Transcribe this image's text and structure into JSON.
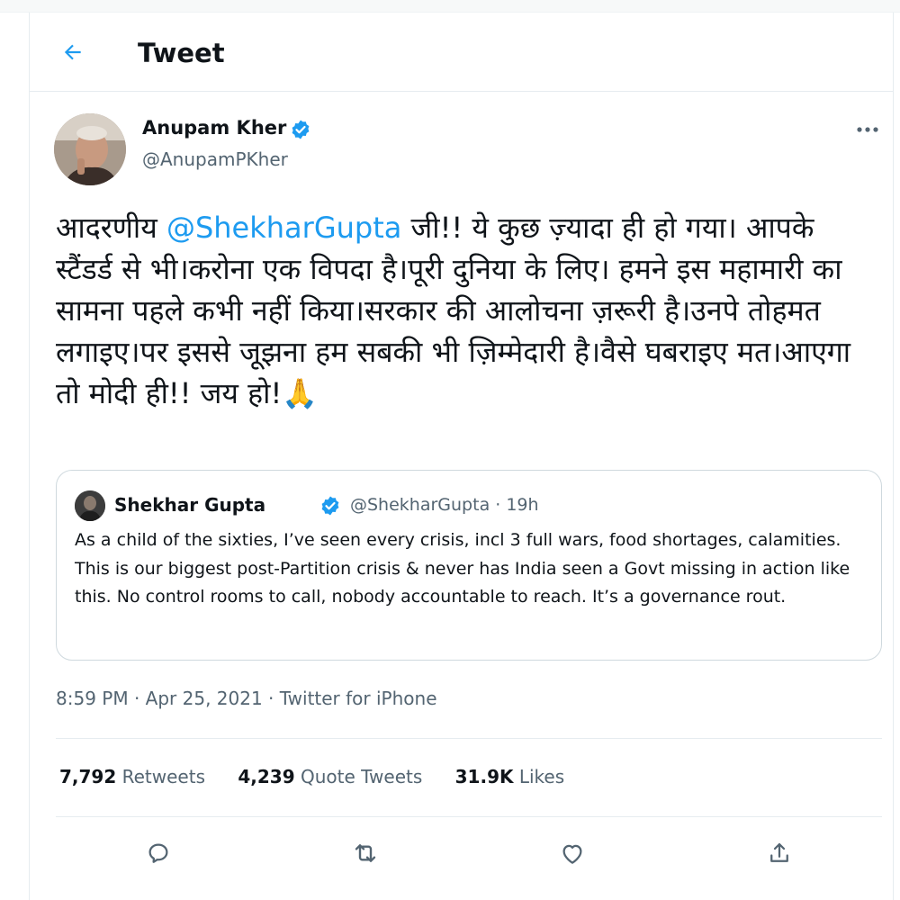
{
  "header": {
    "title": "Tweet",
    "back_icon": "arrow-left-icon"
  },
  "tweet": {
    "author": {
      "name": "Anupam Kher",
      "handle": "@AnupamPKher",
      "verified": true
    },
    "text_before_mention": "आदरणीय ",
    "mention": "@ShekharGupta",
    "text_after_mention": " जी!! ये कुछ ज़्यादा ही हो गया। आपके स्टैंडर्ड से भी।करोना एक विपदा है।पूरी दुनिया के लिए। हमने इस महामारी का सामना पहले कभी नहीं किया।सरकार की आलोचना ज़रूरी है।उनपे तोहमत लगाइए।पर इससे जूझना हम सबकी भी ज़िम्मेदारी है।वैसे घबराइए मत।आएगा तो मोदी ही!! जय हो!🙏",
    "timestamp": "8:59 PM · Apr 25, 2021 · Twitter for iPhone"
  },
  "quoted_tweet": {
    "author_name": "Shekhar Gupta",
    "verified": true,
    "meta": "@ShekharGupta · 19h",
    "text": "As a child of the sixties, I’ve seen every crisis, incl 3 full wars, food shortages, calamities. This is our biggest post-Partition crisis & never has India seen a Govt missing in action like this. No control rooms to call, nobody accountable to reach. It’s a governance rout."
  },
  "stats": {
    "retweets_count": "7,792",
    "retweets_label": "Retweets",
    "quotes_count": "4,239",
    "quotes_label": "Quote Tweets",
    "likes_count": "31.9K",
    "likes_label": "Likes"
  },
  "actions": [
    "reply-icon",
    "retweet-icon",
    "like-icon",
    "share-icon"
  ],
  "colors": {
    "accent": "#1d9bf0",
    "text_primary": "#0f1419",
    "text_secondary": "#536471",
    "border": "#e6ecf0"
  }
}
